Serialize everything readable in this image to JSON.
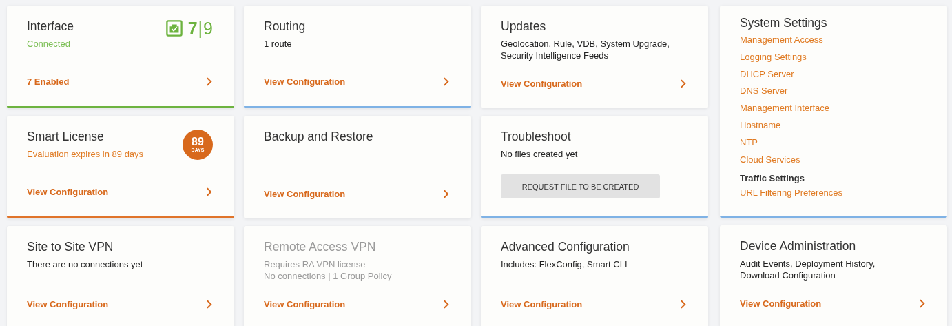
{
  "columns": [
    {
      "cards": [
        {
          "kind": "standard",
          "title": "Interface",
          "disabled": false,
          "color": "#6db33f",
          "details": [
            {
              "text": "Connected",
              "color": "#7cbf55"
            }
          ],
          "counter": {
            "enabled": "7",
            "separator": "|",
            "total": "9"
          },
          "link": "7 Enabled"
        },
        {
          "kind": "standard",
          "title": "Smart License",
          "disabled": false,
          "color": "#e0742a",
          "details": [
            {
              "text": "Evaluation expires in 89 days",
              "color": "#e07a22"
            }
          ],
          "badge": {
            "value": "89",
            "unit": "DAYS"
          },
          "link": "View Configuration"
        },
        {
          "kind": "standard",
          "title": "Site to Site VPN",
          "disabled": false,
          "details": [
            {
              "text": "There are no connections yet"
            }
          ],
          "link": "View Configuration"
        }
      ]
    },
    {
      "cards": [
        {
          "kind": "standard",
          "title": "Routing",
          "disabled": false,
          "color": "#7fb2e5",
          "details": [
            {
              "text": "1 route"
            }
          ],
          "link": "View Configuration"
        },
        {
          "kind": "standard",
          "title": "Backup and Restore",
          "disabled": false,
          "link": "View Configuration"
        },
        {
          "kind": "standard",
          "title": "Remote Access VPN",
          "disabled": true,
          "details": [
            {
              "text": "Requires RA VPN license"
            },
            {
              "text": "No connections | 1 Group Policy"
            }
          ],
          "link": "View Configuration"
        }
      ]
    },
    {
      "cards": [
        {
          "kind": "standard",
          "title": "Updates",
          "disabled": false,
          "details": [
            {
              "text": "Geolocation, Rule, VDB, System Upgrade,"
            },
            {
              "text": "Security Intelligence Feeds"
            }
          ],
          "link": "View Configuration"
        },
        {
          "kind": "action",
          "title": "Troubleshoot",
          "disabled": false,
          "color": "#7fb2e5",
          "details": [
            {
              "text": "No files created yet"
            }
          ],
          "button": "REQUEST FILE TO BE CREATED"
        },
        {
          "kind": "standard",
          "title": "Advanced Configuration",
          "disabled": false,
          "details": [
            {
              "text": "Includes: FlexConfig, Smart CLI"
            }
          ],
          "link": "View Configuration"
        }
      ]
    },
    {
      "cards": [
        {
          "kind": "settings",
          "title": "System Settings",
          "disabled": false,
          "color": "#7fb2e5",
          "groups": [
            {
              "links": [
                "Management Access",
                "Logging Settings",
                "DHCP Server",
                "DNS Server",
                "Management Interface",
                "Hostname",
                "NTP",
                "Cloud Services"
              ]
            },
            {
              "heading": "Traffic Settings",
              "links": [
                "URL Filtering Preferences"
              ]
            }
          ]
        },
        {
          "kind": "standard",
          "title": "Device Administration",
          "disabled": false,
          "details": [
            {
              "text": "Audit Events, Deployment History,"
            },
            {
              "text": "Download Configuration"
            }
          ],
          "link": "View Configuration"
        }
      ]
    }
  ]
}
